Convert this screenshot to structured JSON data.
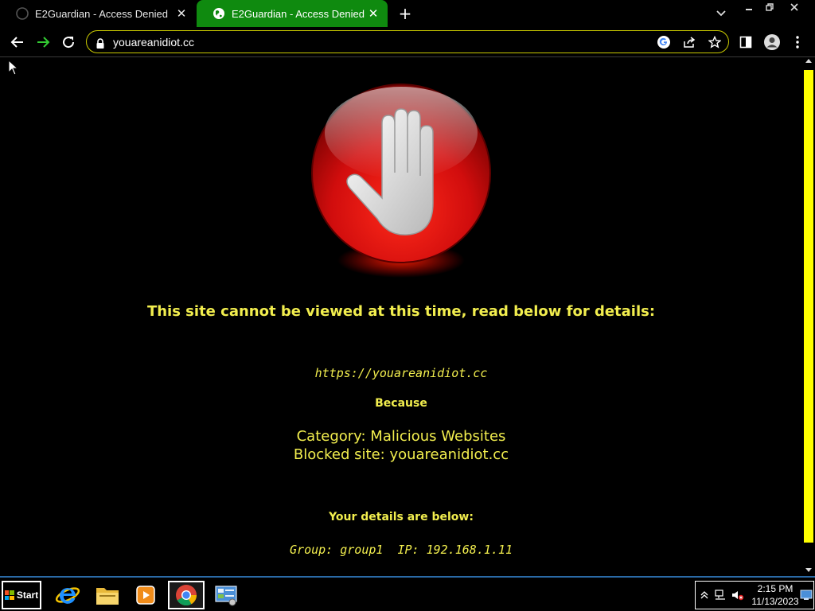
{
  "browser": {
    "tabs": [
      {
        "title": "E2Guardian - Access Denied",
        "active": false
      },
      {
        "title": "E2Guardian - Access Denied",
        "active": true
      }
    ],
    "new_tab_label": "+",
    "close_glyph": "✕",
    "url": "youareanidiot.cc",
    "accent_color": "#0f8a0f",
    "omnibox_border_color": "#c8c800"
  },
  "page": {
    "headline": "This site cannot be viewed at this time, read below for details:",
    "blocked_url": "https://youareanidiot.cc",
    "because": "Because",
    "category": "Category: Malicious Websites",
    "blocked_site": "Blocked site: youareanidiot.cc",
    "your_details": "Your details are below:",
    "group_ip": "Group: group1  IP: 192.168.1.11",
    "text_color": "#f2ee4e",
    "icon": "stop-hand-icon"
  },
  "scrollbar": {
    "thumb_color": "#ffff00"
  },
  "taskbar": {
    "start_label": "Start",
    "apps": [
      "internet-explorer-icon",
      "file-explorer-icon",
      "media-player-icon",
      "chrome-icon",
      "control-panel-icon"
    ],
    "clock_time": "2:15 PM",
    "clock_date": "11/13/2023"
  }
}
